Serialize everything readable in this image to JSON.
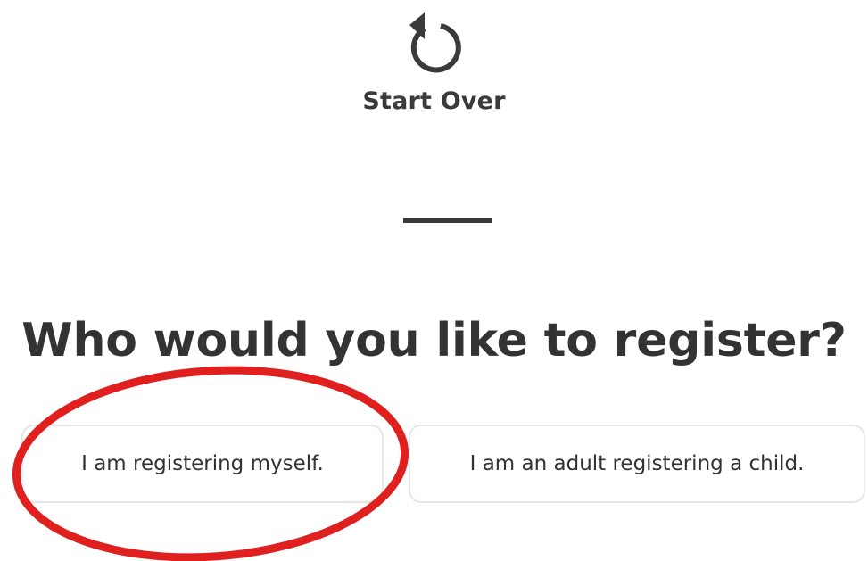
{
  "start_over": {
    "label": "Start Over",
    "icon": "refresh-icon"
  },
  "heading": "Who would you like to register?",
  "options": [
    {
      "label": "I am registering myself."
    },
    {
      "label": "I am an adult registering a child."
    }
  ],
  "annotation": {
    "shape": "ellipse",
    "color": "#e01f1f",
    "target": "I am registering myself."
  },
  "colors": {
    "text": "#333333",
    "border": "#e6e6e6",
    "annotation": "#e01f1f"
  }
}
